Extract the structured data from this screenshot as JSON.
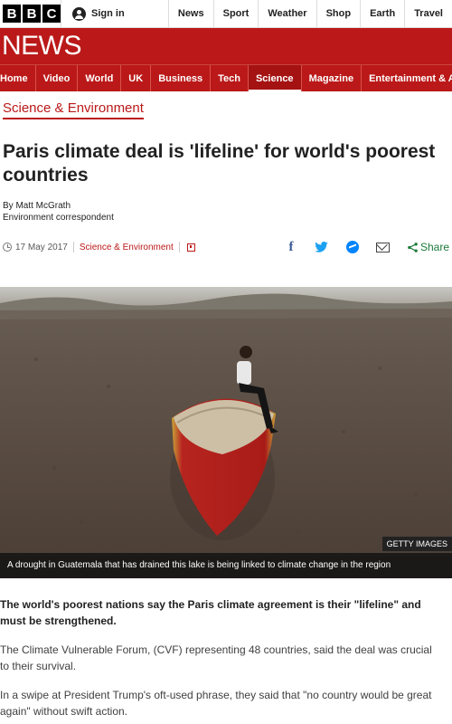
{
  "topbar": {
    "logo_letters": [
      "B",
      "B",
      "C"
    ],
    "signin_label": "Sign in",
    "nav": [
      "News",
      "Sport",
      "Weather",
      "Shop",
      "Earth",
      "Travel"
    ]
  },
  "banner": {
    "title": "NEWS"
  },
  "rednav": {
    "items": [
      "Home",
      "Video",
      "World",
      "UK",
      "Business",
      "Tech",
      "Science",
      "Magazine",
      "Entertainment & A"
    ],
    "active": "Science"
  },
  "section": {
    "label": "Science & Environment"
  },
  "article": {
    "headline": "Paris climate deal is 'lifeline' for world's poorest countries",
    "byline_name": "By Matt McGrath",
    "byline_role": "Environment correspondent",
    "date": "17 May 2017",
    "section_link": "Science & Environment",
    "share_label": "Share",
    "image_credit": "GETTY IMAGES",
    "image_caption": "A drought in Guatemala that has drained this lake is being linked to climate change in the region",
    "lede": "The world's poorest nations say the Paris climate agreement is their \"lifeline\" and must be strengthened.",
    "paragraphs": [
      "The Climate Vulnerable Forum, (CVF) representing 48 countries, said the deal was crucial to their survival.",
      "In a swipe at President Trump's oft-used phrase, they said that \"no country would be great again\" without swift action."
    ]
  },
  "colors": {
    "brand_red": "#bb1919",
    "facebook": "#3b5998",
    "twitter": "#1da1f2",
    "messenger": "#0084ff",
    "share_green": "#1a7a3b"
  },
  "icons": [
    "user-icon",
    "clock-icon",
    "flag-icon",
    "facebook-icon",
    "twitter-icon",
    "messenger-icon",
    "email-icon",
    "share-icon"
  ]
}
